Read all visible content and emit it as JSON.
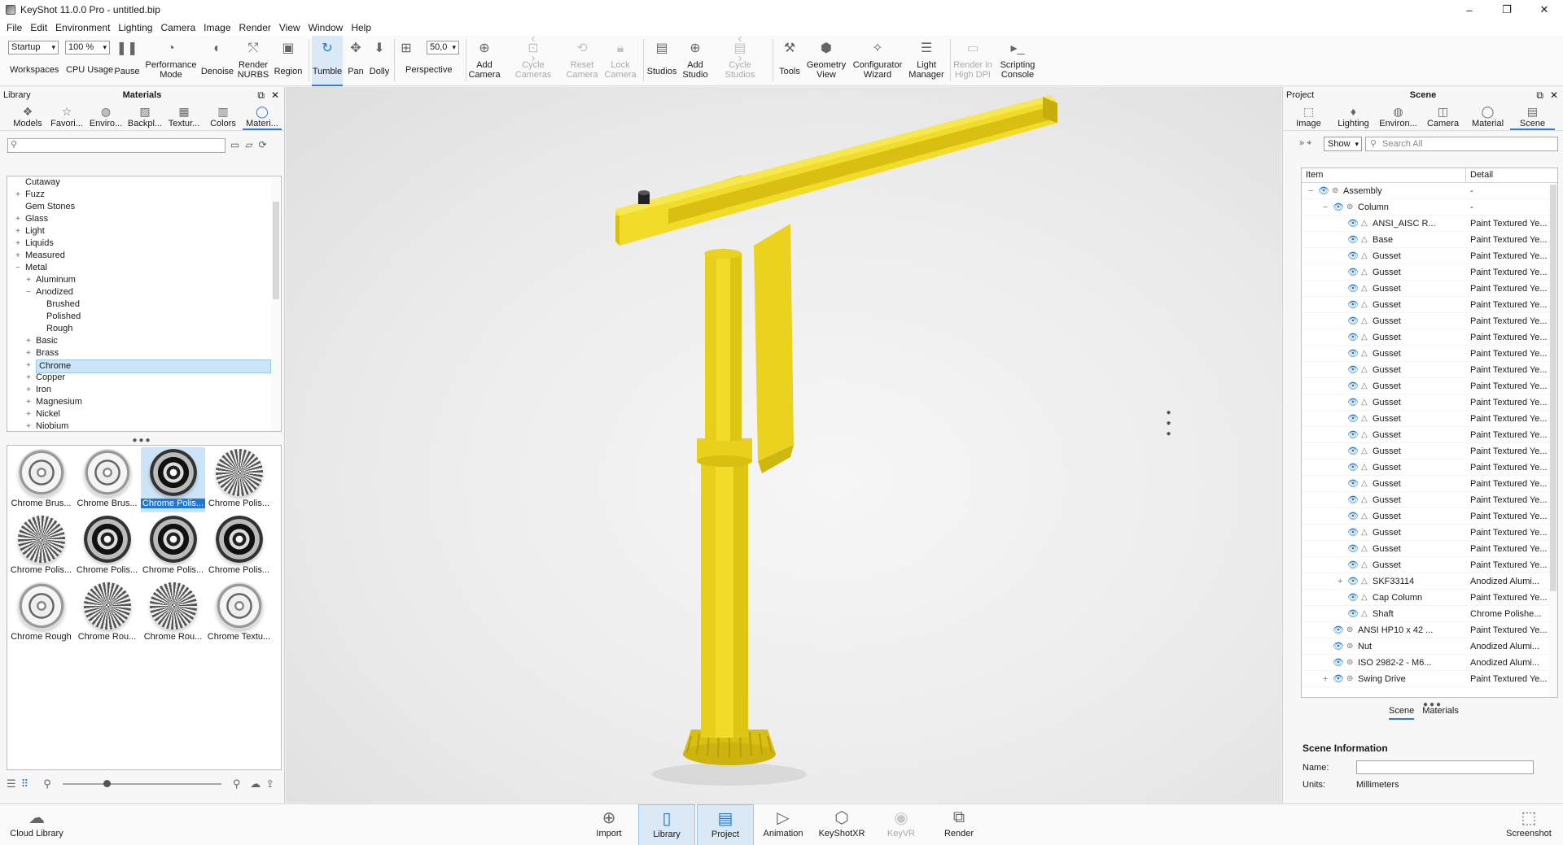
{
  "window": {
    "title": "KeyShot 11.0.0 Pro  - untitled.bip",
    "controls": [
      "–",
      "❐",
      "✕"
    ]
  },
  "menu": [
    "File",
    "Edit",
    "Environment",
    "Lighting",
    "Camera",
    "Image",
    "Render",
    "View",
    "Window",
    "Help"
  ],
  "toolbar": {
    "workspace_value": "Startup",
    "workspace_label": "Workspaces",
    "cpu_value": "100 %",
    "cpu_label": "CPU Usage",
    "pause": "Pause",
    "performance_mode": "Performance\nMode",
    "denoise": "Denoise",
    "render_nurbs": "Render\nNURBS",
    "region": "Region",
    "tumble": "Tumble",
    "pan": "Pan",
    "dolly": "Dolly",
    "fov_value": "50,0",
    "perspective": "Perspective",
    "add_camera": "Add\nCamera",
    "cycle_cameras": "Cycle\nCameras",
    "reset_camera": "Reset\nCamera",
    "lock_camera": "Lock\nCamera",
    "studios": "Studios",
    "add_studio": "Add\nStudio",
    "cycle_studios": "Cycle\nStudios",
    "tools": "Tools",
    "geometry_view": "Geometry\nView",
    "configurator_wizard": "Configurator\nWizard",
    "light_manager": "Light\nManager",
    "render_high_dpi": "Render in\nHigh DPI",
    "scripting_console": "Scripting\nConsole"
  },
  "library": {
    "panel_left": "Library",
    "panel_title": "Materials",
    "tabs": [
      "Models",
      "Favori...",
      "Enviro...",
      "Backpl...",
      "Textur...",
      "Colors",
      "Materi..."
    ],
    "search_placeholder": "",
    "tree": [
      {
        "label": "Cutaway",
        "level": 0,
        "exp": ""
      },
      {
        "label": "Fuzz",
        "level": 0,
        "exp": "+"
      },
      {
        "label": "Gem Stones",
        "level": 0,
        "exp": ""
      },
      {
        "label": "Glass",
        "level": 0,
        "exp": "+"
      },
      {
        "label": "Light",
        "level": 0,
        "exp": "+"
      },
      {
        "label": "Liquids",
        "level": 0,
        "exp": "+"
      },
      {
        "label": "Measured",
        "level": 0,
        "exp": "+"
      },
      {
        "label": "Metal",
        "level": 0,
        "exp": "−"
      },
      {
        "label": "Aluminum",
        "level": 1,
        "exp": "+"
      },
      {
        "label": "Anodized",
        "level": 1,
        "exp": "−"
      },
      {
        "label": "Brushed",
        "level": 2,
        "exp": ""
      },
      {
        "label": "Polished",
        "level": 2,
        "exp": ""
      },
      {
        "label": "Rough",
        "level": 2,
        "exp": ""
      },
      {
        "label": "Basic",
        "level": 1,
        "exp": "+"
      },
      {
        "label": "Brass",
        "level": 1,
        "exp": "+"
      },
      {
        "label": "Chrome",
        "level": 1,
        "exp": "+",
        "selected": true
      },
      {
        "label": "Copper",
        "level": 1,
        "exp": "+"
      },
      {
        "label": "Iron",
        "level": 1,
        "exp": "+"
      },
      {
        "label": "Magnesium",
        "level": 1,
        "exp": "+"
      },
      {
        "label": "Nickel",
        "level": 1,
        "exp": "+"
      },
      {
        "label": "Niobium",
        "level": 1,
        "exp": "+"
      }
    ],
    "materials": [
      {
        "label": "Chrome Brus...",
        "style": "light"
      },
      {
        "label": "Chrome Brus...",
        "style": "light"
      },
      {
        "label": "Chrome Polis...",
        "style": "dark",
        "selected": true
      },
      {
        "label": "Chrome Polis...",
        "style": "knurl"
      },
      {
        "label": "Chrome Polis...",
        "style": "knurl"
      },
      {
        "label": "Chrome Polis...",
        "style": "dark"
      },
      {
        "label": "Chrome Polis...",
        "style": "dark"
      },
      {
        "label": "Chrome Polis...",
        "style": "dark"
      },
      {
        "label": "Chrome Rough",
        "style": "light"
      },
      {
        "label": "Chrome Rou...",
        "style": "knurl"
      },
      {
        "label": "Chrome Rou...",
        "style": "knurl"
      },
      {
        "label": "Chrome Textu...",
        "style": "light"
      }
    ]
  },
  "project": {
    "panel_left": "Project",
    "panel_title": "Scene",
    "tabs": [
      "Image",
      "Lighting",
      "Environ...",
      "Camera",
      "Material",
      "Scene"
    ],
    "show_value": "Show",
    "search_placeholder": "Search All",
    "col_item": "Item",
    "col_detail": "Detail",
    "rows": [
      {
        "name": "Assembly",
        "detail": "-",
        "level": 0,
        "exp": "−"
      },
      {
        "name": "Column",
        "detail": "-",
        "level": 1,
        "exp": "−"
      },
      {
        "name": "ANSI_AISC R...",
        "detail": "Paint Textured Ye...",
        "level": 2,
        "exp": ""
      },
      {
        "name": "Base",
        "detail": "Paint Textured Ye...",
        "level": 2,
        "exp": ""
      },
      {
        "name": "Gusset",
        "detail": "Paint Textured Ye...",
        "level": 2,
        "exp": ""
      },
      {
        "name": "Gusset",
        "detail": "Paint Textured Ye...",
        "level": 2,
        "exp": ""
      },
      {
        "name": "Gusset",
        "detail": "Paint Textured Ye...",
        "level": 2,
        "exp": ""
      },
      {
        "name": "Gusset",
        "detail": "Paint Textured Ye...",
        "level": 2,
        "exp": ""
      },
      {
        "name": "Gusset",
        "detail": "Paint Textured Ye...",
        "level": 2,
        "exp": ""
      },
      {
        "name": "Gusset",
        "detail": "Paint Textured Ye...",
        "level": 2,
        "exp": ""
      },
      {
        "name": "Gusset",
        "detail": "Paint Textured Ye...",
        "level": 2,
        "exp": ""
      },
      {
        "name": "Gusset",
        "detail": "Paint Textured Ye...",
        "level": 2,
        "exp": ""
      },
      {
        "name": "Gusset",
        "detail": "Paint Textured Ye...",
        "level": 2,
        "exp": ""
      },
      {
        "name": "Gusset",
        "detail": "Paint Textured Ye...",
        "level": 2,
        "exp": ""
      },
      {
        "name": "Gusset",
        "detail": "Paint Textured Ye...",
        "level": 2,
        "exp": ""
      },
      {
        "name": "Gusset",
        "detail": "Paint Textured Ye...",
        "level": 2,
        "exp": ""
      },
      {
        "name": "Gusset",
        "detail": "Paint Textured Ye...",
        "level": 2,
        "exp": ""
      },
      {
        "name": "Gusset",
        "detail": "Paint Textured Ye...",
        "level": 2,
        "exp": ""
      },
      {
        "name": "Gusset",
        "detail": "Paint Textured Ye...",
        "level": 2,
        "exp": ""
      },
      {
        "name": "Gusset",
        "detail": "Paint Textured Ye...",
        "level": 2,
        "exp": ""
      },
      {
        "name": "Gusset",
        "detail": "Paint Textured Ye...",
        "level": 2,
        "exp": ""
      },
      {
        "name": "Gusset",
        "detail": "Paint Textured Ye...",
        "level": 2,
        "exp": ""
      },
      {
        "name": "Gusset",
        "detail": "Paint Textured Ye...",
        "level": 2,
        "exp": ""
      },
      {
        "name": "Gusset",
        "detail": "Paint Textured Ye...",
        "level": 2,
        "exp": ""
      },
      {
        "name": "SKF33114",
        "detail": "Anodized Alumi...",
        "level": 2,
        "exp": "+"
      },
      {
        "name": "Cap Column",
        "detail": "Paint Textured Ye...",
        "level": 2,
        "exp": ""
      },
      {
        "name": "Shaft",
        "detail": "Chrome Polishe...",
        "level": 2,
        "exp": ""
      },
      {
        "name": "ANSI HP10 x 42 ...",
        "detail": "Paint Textured Ye...",
        "level": 1,
        "exp": ""
      },
      {
        "name": "Nut",
        "detail": "Anodized Alumi...",
        "level": 1,
        "exp": ""
      },
      {
        "name": "ISO 2982-2 - M6...",
        "detail": "Anodized Alumi...",
        "level": 1,
        "exp": ""
      },
      {
        "name": "Swing Drive",
        "detail": "Paint Textured Ye...",
        "level": 1,
        "exp": "+"
      }
    ],
    "subtabs": [
      "Scene",
      "Materials"
    ],
    "info_title": "Scene Information",
    "name_label": "Name:",
    "name_value": "",
    "units_label": "Units:",
    "units_value": "Millimeters"
  },
  "bottom": {
    "cloud_library": "Cloud Library",
    "import": "Import",
    "library": "Library",
    "project": "Project",
    "animation": "Animation",
    "keyshotxr": "KeyShotXR",
    "keyvr": "KeyVR",
    "render": "Render",
    "screenshot": "Screenshot"
  },
  "colors": {
    "accent": "#2f7fd0",
    "model_yellow": "#f2dc2a",
    "selection": "#cce4f7"
  }
}
